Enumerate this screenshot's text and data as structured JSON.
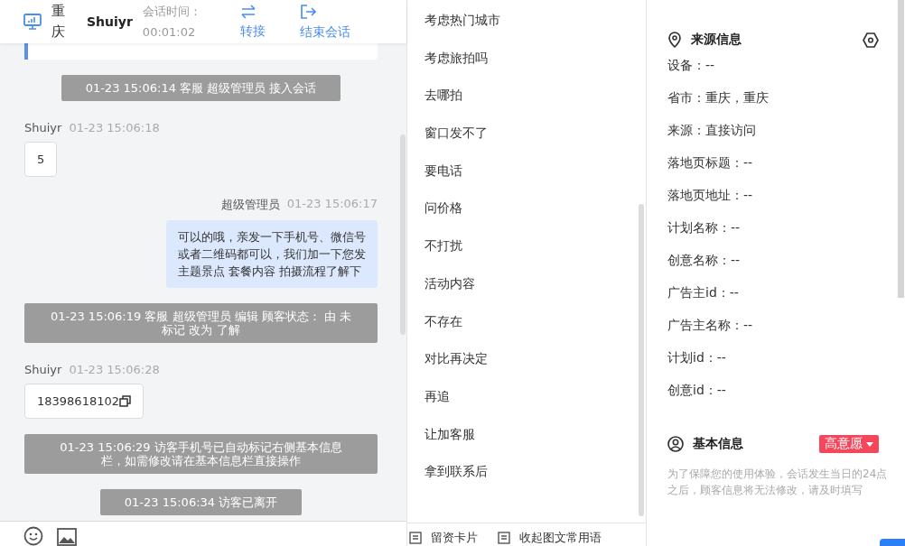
{
  "header": {
    "location": "重庆",
    "visitor": "Shuiyr",
    "duration_label": "会话时间：",
    "duration": "00:01:02",
    "actions": [
      {
        "kind": "transfer",
        "label": "转接"
      },
      {
        "kind": "end",
        "label": "结束会话"
      }
    ]
  },
  "messages": [
    {
      "kind": "system",
      "text": "01-23 15:06:14 客服 超级管理员 接入会话"
    },
    {
      "kind": "visitor",
      "sender": "Shuiyr",
      "time": "01-23 15:06:18",
      "text": "5",
      "copyable": false
    },
    {
      "kind": "agent",
      "sender": "超级管理员",
      "time": "01-23 15:06:17",
      "text": "可以的哦，亲发一下手机号、微信号或者二维码都可以，我们加一下您发主题景点 套餐内容 拍摄流程了解下"
    },
    {
      "kind": "system",
      "text": "01-23 15:06:19 客服 超级管理员 编辑 顾客状态： 由 未标记 改为 了解"
    },
    {
      "kind": "visitor",
      "sender": "Shuiyr",
      "time": "01-23 15:06:28",
      "text": "18398618102",
      "copyable": true
    },
    {
      "kind": "system",
      "text": "01-23 15:06:29 访客手机号已自动标记右侧基本信息栏，如需修改请在基本信息栏直接操作"
    },
    {
      "kind": "system",
      "text": "01-23 15:06:34 访客已离开"
    }
  ],
  "quick_replies": [
    "考虑热门城市",
    "考虑旅拍吗",
    "去哪拍",
    "窗口发不了",
    "要电话",
    "问价格",
    "不打扰",
    "活动内容",
    "不存在",
    "对比再决定",
    "再追",
    "让加客服",
    "拿到联系后"
  ],
  "toolbar": [
    "留资卡片",
    "收起图文常用语"
  ],
  "source_info": {
    "title": "来源信息",
    "fields": [
      "设备：--",
      "省市：重庆，重庆",
      "来源：直接访问",
      "落地页标题：--",
      "落地页地址：--",
      "计划名称：--",
      "创意名称：--",
      "广告主id：--",
      "广告主名称：--",
      "计划id：--",
      "创意id：--"
    ]
  },
  "basic_info": {
    "title": "基本信息",
    "tag": "高意愿",
    "note": "为了保障您的使用体验，会话发生当日的24点之后，顾客信息将无法修改，请及时填写"
  }
}
